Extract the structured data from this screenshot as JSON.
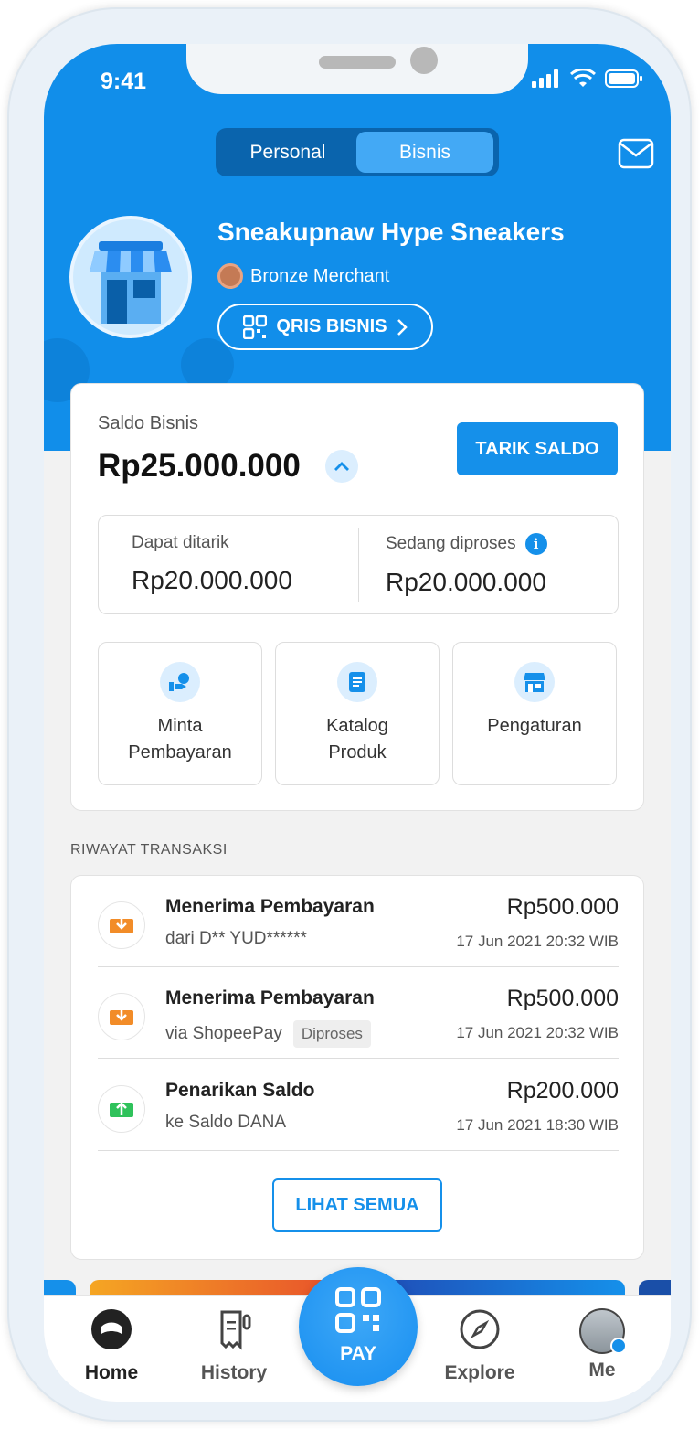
{
  "status_bar": {
    "time": "9:41"
  },
  "header": {
    "segments": [
      "Personal",
      "Bisnis"
    ],
    "active_segment": "Bisnis",
    "merchant_name": "Sneakupnaw Hype Sneakers",
    "tier": "Bronze Merchant",
    "qris_label": "QRIS BISNIS",
    "accent_color": "#118eea"
  },
  "balance": {
    "label": "Saldo Bisnis",
    "value": "Rp25.000.000",
    "withdraw_label": "TARIK SALDO",
    "available": {
      "label": "Dapat ditarik",
      "value": "Rp20.000.000"
    },
    "processing": {
      "label": "Sedang diproses",
      "value": "Rp20.000.000"
    }
  },
  "actions": [
    {
      "label": "Minta\nPembayaran",
      "icon": "hand-coin-icon"
    },
    {
      "label": "Katalog\nProduk",
      "icon": "document-icon"
    },
    {
      "label": "Pengaturan",
      "icon": "store-icon"
    }
  ],
  "transactions": {
    "section_title": "RIWAYAT TRANSAKSI",
    "items": [
      {
        "title": "Menerima Pembayaran",
        "subtitle": "dari D** YUD******",
        "status": "",
        "amount": "Rp500.000",
        "date": "17 Jun 2021 20:32 WIB",
        "icon": "receive-icon"
      },
      {
        "title": "Menerima Pembayaran",
        "subtitle": "via ShopeePay",
        "status": "Diproses",
        "amount": "Rp500.000",
        "date": "17 Jun 2021 20:32 WIB",
        "icon": "receive-icon"
      },
      {
        "title": "Penarikan Saldo",
        "subtitle": "ke Saldo DANA",
        "status": "",
        "amount": "Rp200.000",
        "date": "17 Jun 2021 18:30 WIB",
        "icon": "withdraw-icon"
      }
    ],
    "see_all_label": "LIHAT SEMUA"
  },
  "tabbar": {
    "home": "Home",
    "history": "History",
    "pay": "PAY",
    "explore": "Explore",
    "me": "Me"
  }
}
